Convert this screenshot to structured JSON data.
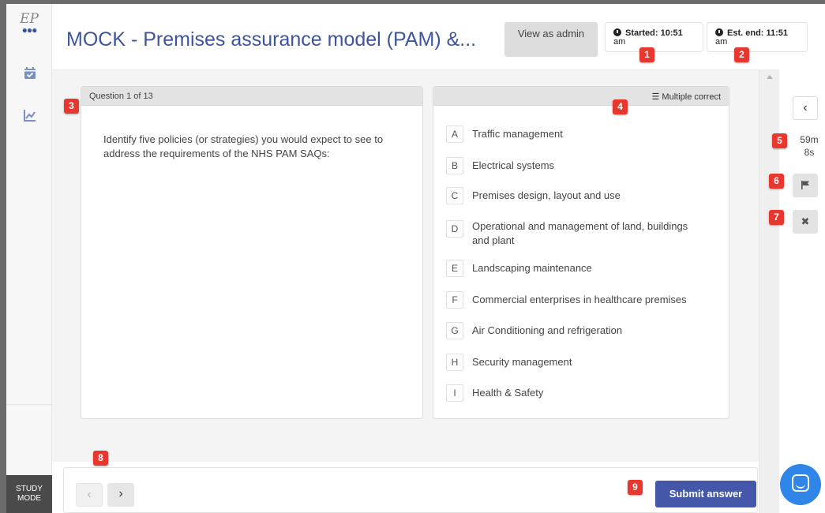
{
  "app": {
    "logo_text": "EP",
    "title": "MOCK - Premises assurance model (PAM) &...",
    "view_as_admin": "View as admin",
    "started_label": "Started: 10:51",
    "started_ampm": "am",
    "est_end_label": "Est. end: 11:51",
    "est_end_ampm": "am",
    "study_mode_line1": "STUDY",
    "study_mode_line2": "MODE"
  },
  "question": {
    "counter": "Question 1 of 13",
    "text": "Identify five policies (or strategies) you would expect to see to address the requirements of the NHS PAM SAQs:",
    "answer_mode": "Multiple correct"
  },
  "options": [
    {
      "letter": "A",
      "text": "Traffic management"
    },
    {
      "letter": "B",
      "text": "Electrical systems"
    },
    {
      "letter": "C",
      "text": "Premises design, layout and use"
    },
    {
      "letter": "D",
      "text": "Operational and management of land, buildings and plant"
    },
    {
      "letter": "E",
      "text": "Landscaping maintenance"
    },
    {
      "letter": "F",
      "text": "Commercial enterprises in healthcare premises"
    },
    {
      "letter": "G",
      "text": "Air Conditioning and refrigeration"
    },
    {
      "letter": "H",
      "text": "Security management"
    },
    {
      "letter": "I",
      "text": "Health & Safety"
    }
  ],
  "sidebar_right": {
    "collapse_glyph": "‹",
    "timer_minutes": "59m",
    "timer_seconds": "8s",
    "close_glyph": "✖"
  },
  "footer": {
    "prev_glyph": "‹",
    "next_glyph": "›",
    "submit_label": "Submit answer"
  },
  "badges": [
    "1",
    "2",
    "3",
    "4",
    "5",
    "6",
    "7",
    "8",
    "9"
  ],
  "colors": {
    "accent": "#3d55a0",
    "submit": "#4457a8",
    "badge": "#e8372f",
    "chat": "#2f85e8"
  }
}
